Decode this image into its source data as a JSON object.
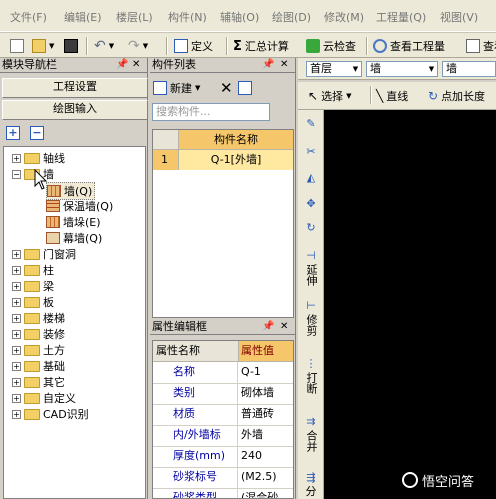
{
  "menu": [
    "文件(F)",
    "编辑(E)",
    "楼层(L)",
    "构件(N)",
    "辅轴(O)",
    "绘图(D)",
    "修改(M)",
    "工程量(Q)",
    "视图(V)"
  ],
  "toolbar": {
    "define": "定义",
    "sum_calc": "汇总计算",
    "cloud_check": "云检查",
    "view_quantity": "查看工程量",
    "view_more": "查看"
  },
  "nav": {
    "title": "模块导航栏",
    "project_settings": "工程设置",
    "drawing_input": "绘图输入",
    "tree": [
      {
        "label": "轴线",
        "expanded": false
      },
      {
        "label": "墙",
        "expanded": true,
        "children": [
          "墙(Q)",
          "保温墙(Q)",
          "墙垛(E)",
          "幕墙(Q)"
        ]
      },
      {
        "label": "门窗洞",
        "expanded": false
      },
      {
        "label": "柱",
        "expanded": false
      },
      {
        "label": "梁",
        "expanded": false
      },
      {
        "label": "板",
        "expanded": false
      },
      {
        "label": "楼梯",
        "expanded": false
      },
      {
        "label": "装修",
        "expanded": false
      },
      {
        "label": "土方",
        "expanded": false
      },
      {
        "label": "基础",
        "expanded": false
      },
      {
        "label": "其它",
        "expanded": false
      },
      {
        "label": "自定义",
        "expanded": false
      },
      {
        "label": "CAD识别",
        "expanded": false
      }
    ]
  },
  "component_list": {
    "title": "构件列表",
    "new_label": "新建",
    "search_placeholder": "搜索构件...",
    "column_header": "构件名称",
    "rows": [
      {
        "index": "1",
        "name": "Q-1[外墙]"
      }
    ]
  },
  "properties": {
    "title": "属性编辑框",
    "col_name": "属性名称",
    "col_value": "属性值",
    "rows": [
      {
        "name": "名称",
        "value": "Q-1"
      },
      {
        "name": "类别",
        "value": "砌体墙"
      },
      {
        "name": "材质",
        "value": "普通砖"
      },
      {
        "name": "内/外墙标",
        "value": "外墙"
      },
      {
        "name": "厚度(mm)",
        "value": "240"
      },
      {
        "name": "砂浆标号",
        "value": "(M2.5)"
      },
      {
        "name": "砂浆类型",
        "value": "(混合砂"
      }
    ]
  },
  "floor_bar": {
    "floor": "首层",
    "type": "墙",
    "component": "墙"
  },
  "draw_bar": {
    "select": "选择",
    "line": "直线",
    "point_length": "点加长度"
  },
  "vertical_tools": {
    "extend": "延伸",
    "trim": "修剪",
    "break": "打断",
    "merge": "合并",
    "split": "分"
  },
  "watermark": "悟空问答",
  "colors": {
    "canvas": "#000000",
    "panel": "#d4d0c8",
    "header_highlight": "#f6c76a",
    "row_highlight": "#ffe8a0"
  }
}
